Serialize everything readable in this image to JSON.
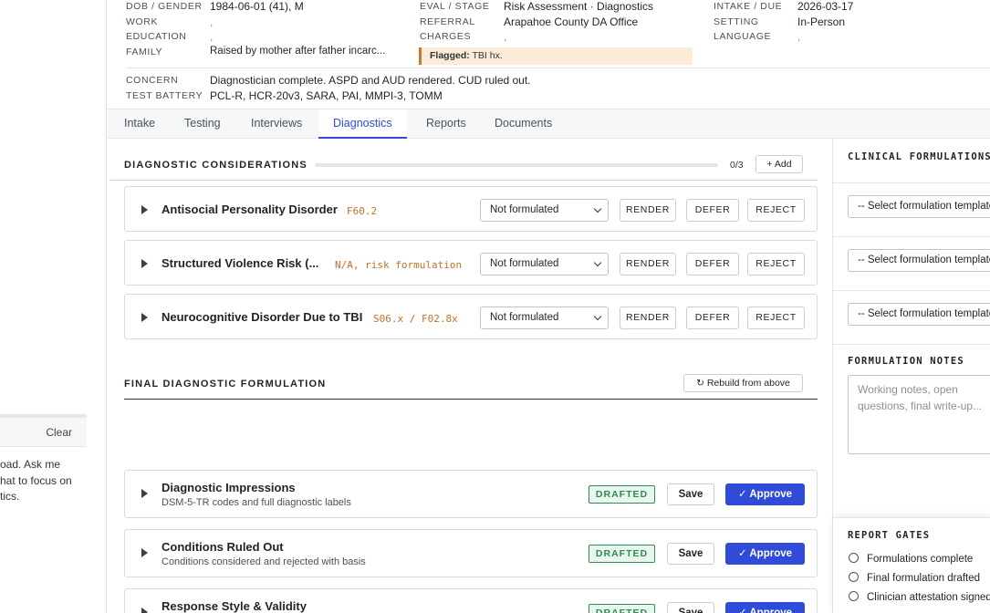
{
  "assistant_panel": {
    "clear_label": "Clear",
    "message_lines": [
      "oad. Ask me",
      "hat to focus on",
      "tics."
    ]
  },
  "case": {
    "fields": {
      "dob_gender": {
        "label": "DOB / GENDER",
        "value": "1984-06-01 (41), M"
      },
      "work": {
        "label": "WORK",
        "value": ","
      },
      "education": {
        "label": "EDUCATION",
        "value": ","
      },
      "family": {
        "label": "FAMILY",
        "value": "Raised by mother after father incarc..."
      },
      "eval_stage": {
        "label": "EVAL / STAGE",
        "value": "Risk Assessment · Diagnostics"
      },
      "referral": {
        "label": "REFERRAL",
        "value": "Arapahoe County DA Office"
      },
      "charges": {
        "label": "CHARGES",
        "value": ","
      },
      "intake_due": {
        "label": "INTAKE / DUE",
        "value": "2026-03-17"
      },
      "setting": {
        "label": "SETTING",
        "value": "In-Person"
      },
      "language": {
        "label": "LANGUAGE",
        "value": ","
      },
      "concern": {
        "label": "CONCERN",
        "value": "Diagnostician complete. ASPD and AUD rendered. CUD ruled out."
      },
      "test_battery": {
        "label": "TEST BATTERY",
        "value": "PCL-R, HCR-20v3, SARA, PAI, MMPI-3, TOMM"
      }
    },
    "flag": {
      "label": "Flagged:",
      "text": "TBI hx."
    }
  },
  "tabs": [
    "Intake",
    "Testing",
    "Interviews",
    "Diagnostics",
    "Reports",
    "Documents"
  ],
  "active_tab": "Diagnostics",
  "diagnostic_considerations": {
    "title": "DIAGNOSTIC CONSIDERATIONS",
    "progress": 0,
    "count": "0/3",
    "add_label": "+ Add",
    "items": [
      {
        "name": "Antisocial Personality Disorder",
        "code": "F60.2",
        "status": "Not formulated"
      },
      {
        "name": "Structured Violence Risk (...",
        "code": "N/A, risk formulation",
        "status": "Not formulated"
      },
      {
        "name": "Neurocognitive Disorder Due to TBI",
        "code": "S06.x / F02.8x",
        "status": "Not formulated"
      }
    ],
    "actions": {
      "render": "RENDER",
      "defer": "DEFER",
      "reject": "REJECT"
    }
  },
  "final_formulation": {
    "title": "FINAL DIAGNOSTIC FORMULATION",
    "rebuild_label": "↻ Rebuild from above",
    "sections": [
      {
        "title": "Diagnostic Impressions",
        "subtitle": "DSM-5-TR codes and full diagnostic labels",
        "status": "DRAFTED"
      },
      {
        "title": "Conditions Ruled Out",
        "subtitle": "Conditions considered and rejected with basis",
        "status": "DRAFTED"
      },
      {
        "title": "Response Style & Validity",
        "subtitle": "",
        "status": "DRAFTED"
      }
    ],
    "save_label": "Save",
    "approve_label": "✓ Approve"
  },
  "clinical_formulations": {
    "title": "CLINICAL FORMULATIONS",
    "select_placeholder": "-- Select formulation template --",
    "notes_title": "FORMULATION NOTES",
    "notes_placeholder": "Working notes, open questions, final write-up..."
  },
  "report_gates": {
    "title": "REPORT GATES",
    "items": [
      "Formulations complete",
      "Final formulation drafted",
      "Clinician attestation signed"
    ]
  },
  "colors": {
    "accent": "#2f4bd8",
    "code": "#c0702a",
    "drafted": "#2e8a57",
    "flag_bg": "#faecd9"
  }
}
